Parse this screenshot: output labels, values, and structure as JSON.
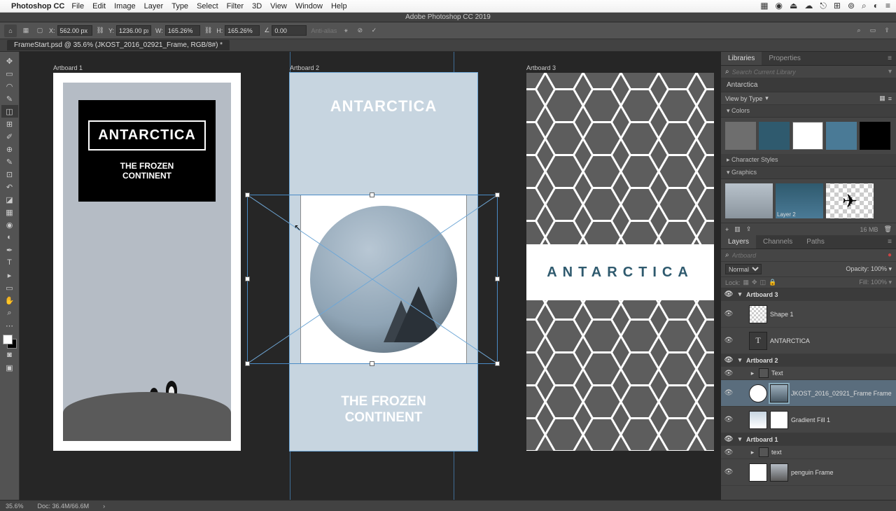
{
  "mac_menu": {
    "app": "Photoshop CC",
    "items": [
      "File",
      "Edit",
      "Image",
      "Layer",
      "Type",
      "Select",
      "Filter",
      "3D",
      "View",
      "Window",
      "Help"
    ]
  },
  "title_bar": "Adobe Photoshop CC 2019",
  "options": {
    "x": "562.00 px",
    "y": "1236.00 px",
    "w": "165.26%",
    "h": "165.26%",
    "angle": "0.00",
    "antialias": "Anti-alias"
  },
  "doc_tab": "FrameStart.psd @ 35.6% (JKOST_2016_02921_Frame, RGB/8#) *",
  "artboards": {
    "ab1": {
      "label": "Artboard 1",
      "title": "ANTARCTICA",
      "sub": "THE FROZEN\nCONTINENT"
    },
    "ab2": {
      "label": "Artboard 2",
      "title": "ANTARCTICA",
      "sub": "THE FROZEN\nCONTINENT"
    },
    "ab3": {
      "label": "Artboard 3",
      "title": "ANTARCTICA"
    }
  },
  "libraries": {
    "tab1": "Libraries",
    "tab2": "Properties",
    "search_placeholder": "Search Current Library",
    "name": "Antarctica",
    "view_label": "View by Type",
    "sec_colors": "Colors",
    "colors": [
      "#6e6e6e",
      "#2f5a6e",
      "#ffffff",
      "#4a7a96",
      "#000000"
    ],
    "sec_char": "Character Styles",
    "sec_graphics": "Graphics",
    "graphic2_label": "Layer 2",
    "footer_size": "16 MB"
  },
  "layers_panel": {
    "tabs": [
      "Layers",
      "Channels",
      "Paths"
    ],
    "kind_placeholder": "Artboard",
    "blend": "Normal",
    "opacity_label": "Opacity:",
    "opacity": "100%",
    "fill_label": "Fill:",
    "fill": "100%",
    "lock_label": "Lock:",
    "items": [
      {
        "t": "ab",
        "name": "Artboard 3"
      },
      {
        "t": "layer",
        "name": "Shape 1",
        "indent": 1
      },
      {
        "t": "text",
        "name": "ANTARCTICA",
        "indent": 1
      },
      {
        "t": "ab",
        "name": "Artboard 2"
      },
      {
        "t": "group",
        "name": "Text",
        "indent": 1
      },
      {
        "t": "frame",
        "name": "JKOST_2016_02921_Frame Frame",
        "indent": 1,
        "selected": true
      },
      {
        "t": "adj",
        "name": "Gradient Fill 1",
        "indent": 1
      },
      {
        "t": "ab",
        "name": "Artboard 1"
      },
      {
        "t": "group",
        "name": "text",
        "indent": 1
      },
      {
        "t": "frame",
        "name": "penguin Frame",
        "indent": 1
      }
    ]
  },
  "status": {
    "zoom": "35.6%",
    "doc": "Doc: 36.4M/66.6M"
  }
}
